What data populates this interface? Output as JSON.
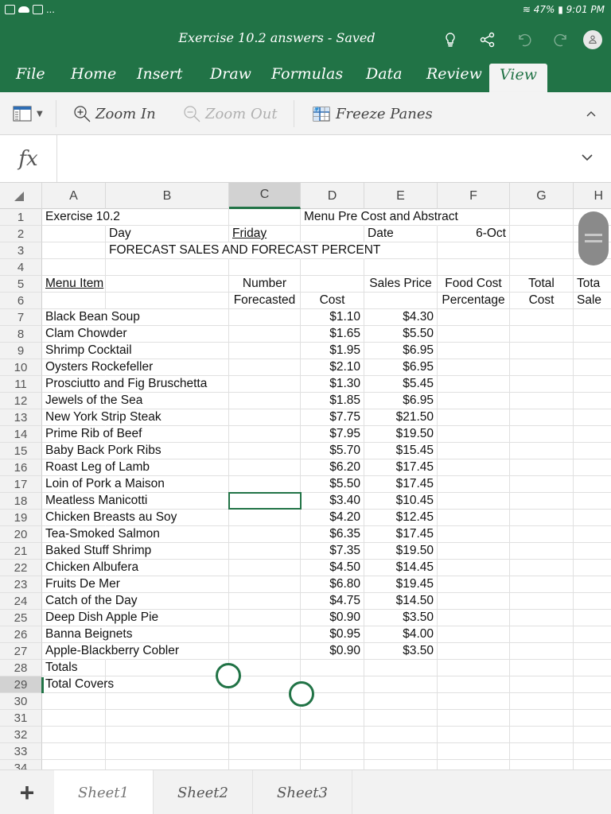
{
  "status_bar": {
    "left_icons": [
      "mail-icon",
      "cloud-icon",
      "mail-icon"
    ],
    "more": "...",
    "wifi": "wifi-icon",
    "battery_percent": "47%",
    "time": "9:01 PM"
  },
  "title_bar": {
    "document_title": "Exercise 10.2 answers - Saved",
    "icons": [
      "lightbulb-icon",
      "share-icon",
      "undo-icon",
      "redo-icon",
      "account-icon"
    ]
  },
  "ribbon_tabs": [
    {
      "label": "File",
      "active": false
    },
    {
      "label": "Home",
      "active": false
    },
    {
      "label": "Insert",
      "active": false
    },
    {
      "label": "Draw",
      "active": false
    },
    {
      "label": "Formulas",
      "active": false
    },
    {
      "label": "Data",
      "active": false
    },
    {
      "label": "Review",
      "active": false
    },
    {
      "label": "View",
      "active": true
    }
  ],
  "ribbon": {
    "layout_dropdown": "sheet-view-icon",
    "zoom_in": "Zoom In",
    "zoom_out": "Zoom Out",
    "freeze_panes": "Freeze Panes",
    "collapse": "chevron-up-icon"
  },
  "formula_bar": {
    "fx_label": "fx",
    "value": ""
  },
  "columns": [
    "A",
    "B",
    "C",
    "D",
    "E",
    "F",
    "G",
    "H"
  ],
  "selected_column": "C",
  "selected_row": "29",
  "selected_cell": "C29",
  "sheet": {
    "r1": {
      "A": "Exercise 10.2",
      "D": "Menu Pre Cost and Abstract"
    },
    "r2": {
      "B": "Day",
      "C": "Friday",
      "E": "Date",
      "F": "6-Oct"
    },
    "r3": {
      "B": "FORECAST SALES AND FORECAST PERCENT"
    },
    "r5": {
      "A": "Menu Item",
      "C": "Number",
      "E": "Sales Price",
      "F": "Food Cost",
      "G": "Total",
      "H": "Tota"
    },
    "r6": {
      "C": "Forecasted",
      "D": "Cost",
      "F": "Percentage",
      "G": "Cost",
      "H": "Sale"
    },
    "items": [
      {
        "row": "7",
        "name": "Black Bean Soup",
        "cost": "$1.10",
        "price": "$4.30"
      },
      {
        "row": "8",
        "name": "Clam Chowder",
        "cost": "$1.65",
        "price": "$5.50"
      },
      {
        "row": "9",
        "name": "Shrimp Cocktail",
        "cost": "$1.95",
        "price": "$6.95"
      },
      {
        "row": "10",
        "name": "Oysters Rockefeller",
        "cost": "$2.10",
        "price": "$6.95"
      },
      {
        "row": "11",
        "name": "Prosciutto and Fig Bruschetta",
        "cost": "$1.30",
        "price": "$5.45"
      },
      {
        "row": "12",
        "name": "Jewels of the Sea",
        "cost": "$1.85",
        "price": "$6.95"
      },
      {
        "row": "13",
        "name": "New York Strip Steak",
        "cost": "$7.75",
        "price": "$21.50"
      },
      {
        "row": "14",
        "name": "Prime Rib of Beef",
        "cost": "$7.95",
        "price": "$19.50"
      },
      {
        "row": "15",
        "name": "Baby Back Pork Ribs",
        "cost": "$5.70",
        "price": "$15.45"
      },
      {
        "row": "16",
        "name": "Roast Leg of Lamb",
        "cost": "$6.20",
        "price": "$17.45"
      },
      {
        "row": "17",
        "name": "Loin of Pork a Maison",
        "cost": "$5.50",
        "price": "$17.45"
      },
      {
        "row": "18",
        "name": "Meatless Manicotti",
        "cost": "$3.40",
        "price": "$10.45"
      },
      {
        "row": "19",
        "name": "Chicken Breasts au Soy",
        "cost": "$4.20",
        "price": "$12.45"
      },
      {
        "row": "20",
        "name": "Tea-Smoked Salmon",
        "cost": "$6.35",
        "price": "$17.45"
      },
      {
        "row": "21",
        "name": "Baked Stuff Shrimp",
        "cost": "$7.35",
        "price": "$19.50"
      },
      {
        "row": "22",
        "name": "Chicken Albufera",
        "cost": "$4.50",
        "price": "$14.45"
      },
      {
        "row": "23",
        "name": "Fruits De Mer",
        "cost": "$6.80",
        "price": "$19.45"
      },
      {
        "row": "24",
        "name": "Catch of the Day",
        "cost": "$4.75",
        "price": "$14.50"
      },
      {
        "row": "25",
        "name": "Deep Dish Apple Pie",
        "cost": "$0.90",
        "price": "$3.50"
      },
      {
        "row": "26",
        "name": "Banna Beignets",
        "cost": "$0.95",
        "price": "$4.00"
      },
      {
        "row": "27",
        "name": "Apple-Blackberry Cobler",
        "cost": "$0.90",
        "price": "$3.50"
      }
    ],
    "r28": {
      "A": "Totals"
    },
    "r29": {
      "A": "Total Covers"
    },
    "row_numbers": [
      "1",
      "2",
      "3",
      "4",
      "5",
      "6",
      "7",
      "8",
      "9",
      "10",
      "11",
      "12",
      "13",
      "14",
      "15",
      "16",
      "17",
      "18",
      "19",
      "20",
      "21",
      "22",
      "23",
      "24",
      "25",
      "26",
      "27",
      "28",
      "29",
      "30",
      "31",
      "32",
      "33",
      "34"
    ]
  },
  "sheet_tabs": [
    {
      "label": "Sheet1",
      "active": true
    },
    {
      "label": "Sheet2",
      "active": false
    },
    {
      "label": "Sheet3",
      "active": false
    }
  ],
  "add_sheet_label": "+",
  "colors": {
    "brand_green": "#217346",
    "ribbon_bg": "#f3f3f3",
    "header_bg": "#f2f2f2",
    "selected_header_bg": "#d2d2d2"
  }
}
